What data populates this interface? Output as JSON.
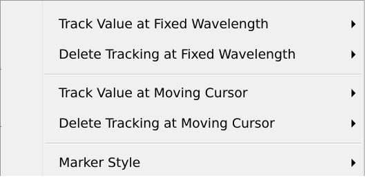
{
  "context_menu": {
    "items": [
      {
        "label": "Track Value at Fixed Wavelength",
        "has_submenu": true
      },
      {
        "label": "Delete Tracking at Fixed Wavelength",
        "has_submenu": true
      },
      {
        "label": "Track Value at Moving Cursor",
        "has_submenu": true
      },
      {
        "label": "Delete Tracking at Moving Cursor",
        "has_submenu": true
      },
      {
        "label": "Marker Style",
        "has_submenu": true
      }
    ]
  },
  "icons": {
    "submenu": "triangle-right-icon"
  },
  "colors": {
    "menu_bg": "#f0f0f0",
    "border": "#979797",
    "separator": "#c9c9c9",
    "text": "#000000"
  }
}
